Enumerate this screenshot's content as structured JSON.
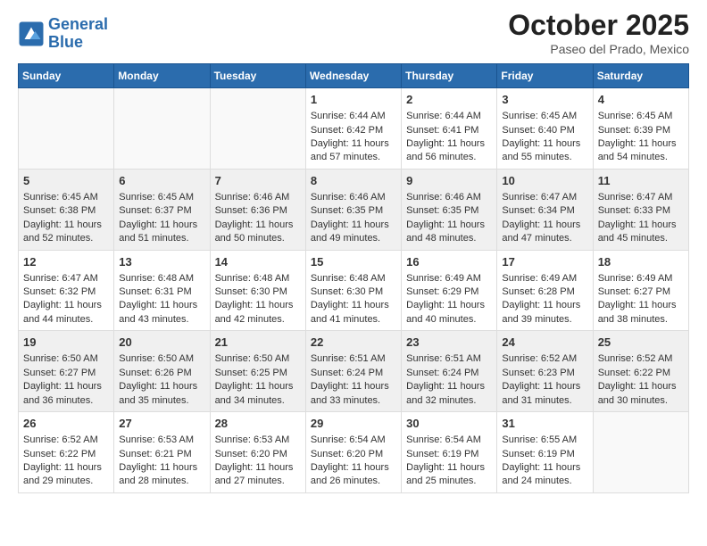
{
  "logo": {
    "line1": "General",
    "line2": "Blue"
  },
  "title": "October 2025",
  "subtitle": "Paseo del Prado, Mexico",
  "days_of_week": [
    "Sunday",
    "Monday",
    "Tuesday",
    "Wednesday",
    "Thursday",
    "Friday",
    "Saturday"
  ],
  "weeks": [
    [
      {
        "day": "",
        "sunrise": "",
        "sunset": "",
        "daylight": ""
      },
      {
        "day": "",
        "sunrise": "",
        "sunset": "",
        "daylight": ""
      },
      {
        "day": "",
        "sunrise": "",
        "sunset": "",
        "daylight": ""
      },
      {
        "day": "1",
        "sunrise": "Sunrise: 6:44 AM",
        "sunset": "Sunset: 6:42 PM",
        "daylight": "Daylight: 11 hours and 57 minutes."
      },
      {
        "day": "2",
        "sunrise": "Sunrise: 6:44 AM",
        "sunset": "Sunset: 6:41 PM",
        "daylight": "Daylight: 11 hours and 56 minutes."
      },
      {
        "day": "3",
        "sunrise": "Sunrise: 6:45 AM",
        "sunset": "Sunset: 6:40 PM",
        "daylight": "Daylight: 11 hours and 55 minutes."
      },
      {
        "day": "4",
        "sunrise": "Sunrise: 6:45 AM",
        "sunset": "Sunset: 6:39 PM",
        "daylight": "Daylight: 11 hours and 54 minutes."
      }
    ],
    [
      {
        "day": "5",
        "sunrise": "Sunrise: 6:45 AM",
        "sunset": "Sunset: 6:38 PM",
        "daylight": "Daylight: 11 hours and 52 minutes."
      },
      {
        "day": "6",
        "sunrise": "Sunrise: 6:45 AM",
        "sunset": "Sunset: 6:37 PM",
        "daylight": "Daylight: 11 hours and 51 minutes."
      },
      {
        "day": "7",
        "sunrise": "Sunrise: 6:46 AM",
        "sunset": "Sunset: 6:36 PM",
        "daylight": "Daylight: 11 hours and 50 minutes."
      },
      {
        "day": "8",
        "sunrise": "Sunrise: 6:46 AM",
        "sunset": "Sunset: 6:35 PM",
        "daylight": "Daylight: 11 hours and 49 minutes."
      },
      {
        "day": "9",
        "sunrise": "Sunrise: 6:46 AM",
        "sunset": "Sunset: 6:35 PM",
        "daylight": "Daylight: 11 hours and 48 minutes."
      },
      {
        "day": "10",
        "sunrise": "Sunrise: 6:47 AM",
        "sunset": "Sunset: 6:34 PM",
        "daylight": "Daylight: 11 hours and 47 minutes."
      },
      {
        "day": "11",
        "sunrise": "Sunrise: 6:47 AM",
        "sunset": "Sunset: 6:33 PM",
        "daylight": "Daylight: 11 hours and 45 minutes."
      }
    ],
    [
      {
        "day": "12",
        "sunrise": "Sunrise: 6:47 AM",
        "sunset": "Sunset: 6:32 PM",
        "daylight": "Daylight: 11 hours and 44 minutes."
      },
      {
        "day": "13",
        "sunrise": "Sunrise: 6:48 AM",
        "sunset": "Sunset: 6:31 PM",
        "daylight": "Daylight: 11 hours and 43 minutes."
      },
      {
        "day": "14",
        "sunrise": "Sunrise: 6:48 AM",
        "sunset": "Sunset: 6:30 PM",
        "daylight": "Daylight: 11 hours and 42 minutes."
      },
      {
        "day": "15",
        "sunrise": "Sunrise: 6:48 AM",
        "sunset": "Sunset: 6:30 PM",
        "daylight": "Daylight: 11 hours and 41 minutes."
      },
      {
        "day": "16",
        "sunrise": "Sunrise: 6:49 AM",
        "sunset": "Sunset: 6:29 PM",
        "daylight": "Daylight: 11 hours and 40 minutes."
      },
      {
        "day": "17",
        "sunrise": "Sunrise: 6:49 AM",
        "sunset": "Sunset: 6:28 PM",
        "daylight": "Daylight: 11 hours and 39 minutes."
      },
      {
        "day": "18",
        "sunrise": "Sunrise: 6:49 AM",
        "sunset": "Sunset: 6:27 PM",
        "daylight": "Daylight: 11 hours and 38 minutes."
      }
    ],
    [
      {
        "day": "19",
        "sunrise": "Sunrise: 6:50 AM",
        "sunset": "Sunset: 6:27 PM",
        "daylight": "Daylight: 11 hours and 36 minutes."
      },
      {
        "day": "20",
        "sunrise": "Sunrise: 6:50 AM",
        "sunset": "Sunset: 6:26 PM",
        "daylight": "Daylight: 11 hours and 35 minutes."
      },
      {
        "day": "21",
        "sunrise": "Sunrise: 6:50 AM",
        "sunset": "Sunset: 6:25 PM",
        "daylight": "Daylight: 11 hours and 34 minutes."
      },
      {
        "day": "22",
        "sunrise": "Sunrise: 6:51 AM",
        "sunset": "Sunset: 6:24 PM",
        "daylight": "Daylight: 11 hours and 33 minutes."
      },
      {
        "day": "23",
        "sunrise": "Sunrise: 6:51 AM",
        "sunset": "Sunset: 6:24 PM",
        "daylight": "Daylight: 11 hours and 32 minutes."
      },
      {
        "day": "24",
        "sunrise": "Sunrise: 6:52 AM",
        "sunset": "Sunset: 6:23 PM",
        "daylight": "Daylight: 11 hours and 31 minutes."
      },
      {
        "day": "25",
        "sunrise": "Sunrise: 6:52 AM",
        "sunset": "Sunset: 6:22 PM",
        "daylight": "Daylight: 11 hours and 30 minutes."
      }
    ],
    [
      {
        "day": "26",
        "sunrise": "Sunrise: 6:52 AM",
        "sunset": "Sunset: 6:22 PM",
        "daylight": "Daylight: 11 hours and 29 minutes."
      },
      {
        "day": "27",
        "sunrise": "Sunrise: 6:53 AM",
        "sunset": "Sunset: 6:21 PM",
        "daylight": "Daylight: 11 hours and 28 minutes."
      },
      {
        "day": "28",
        "sunrise": "Sunrise: 6:53 AM",
        "sunset": "Sunset: 6:20 PM",
        "daylight": "Daylight: 11 hours and 27 minutes."
      },
      {
        "day": "29",
        "sunrise": "Sunrise: 6:54 AM",
        "sunset": "Sunset: 6:20 PM",
        "daylight": "Daylight: 11 hours and 26 minutes."
      },
      {
        "day": "30",
        "sunrise": "Sunrise: 6:54 AM",
        "sunset": "Sunset: 6:19 PM",
        "daylight": "Daylight: 11 hours and 25 minutes."
      },
      {
        "day": "31",
        "sunrise": "Sunrise: 6:55 AM",
        "sunset": "Sunset: 6:19 PM",
        "daylight": "Daylight: 11 hours and 24 minutes."
      },
      {
        "day": "",
        "sunrise": "",
        "sunset": "",
        "daylight": ""
      }
    ]
  ]
}
